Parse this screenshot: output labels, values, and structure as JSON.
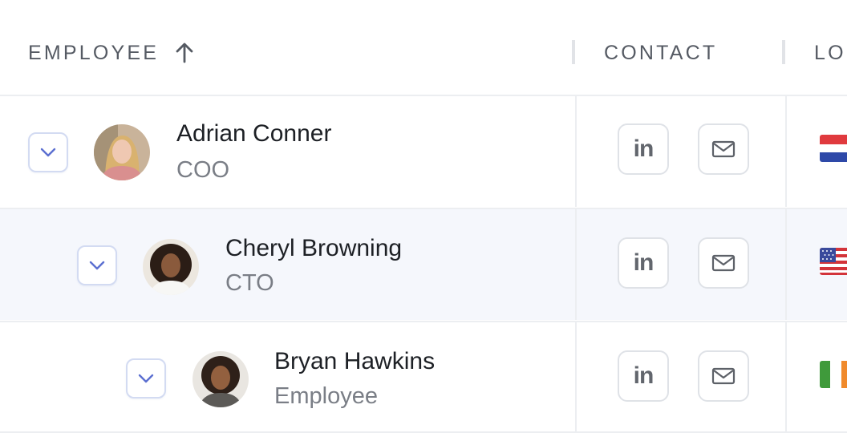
{
  "header": {
    "employee_label": "EMPLOYEE",
    "contact_label": "CONTACT",
    "location_label": "LO"
  },
  "rows": [
    {
      "name": "Adrian Conner",
      "role": "COO",
      "linkedin_label": "in",
      "flag": "netherlands-flag"
    },
    {
      "name": "Cheryl Browning",
      "role": "CTO",
      "linkedin_label": "in",
      "flag": "usa-flag"
    },
    {
      "name": "Bryan Hawkins",
      "role": "Employee",
      "linkedin_label": "in",
      "flag": "ireland-flag"
    }
  ],
  "colors": {
    "header_text": "#555a63",
    "highlight_row": "#f5f7fc",
    "expand_chevron": "#5b6fd1",
    "border": "#eceef1"
  }
}
